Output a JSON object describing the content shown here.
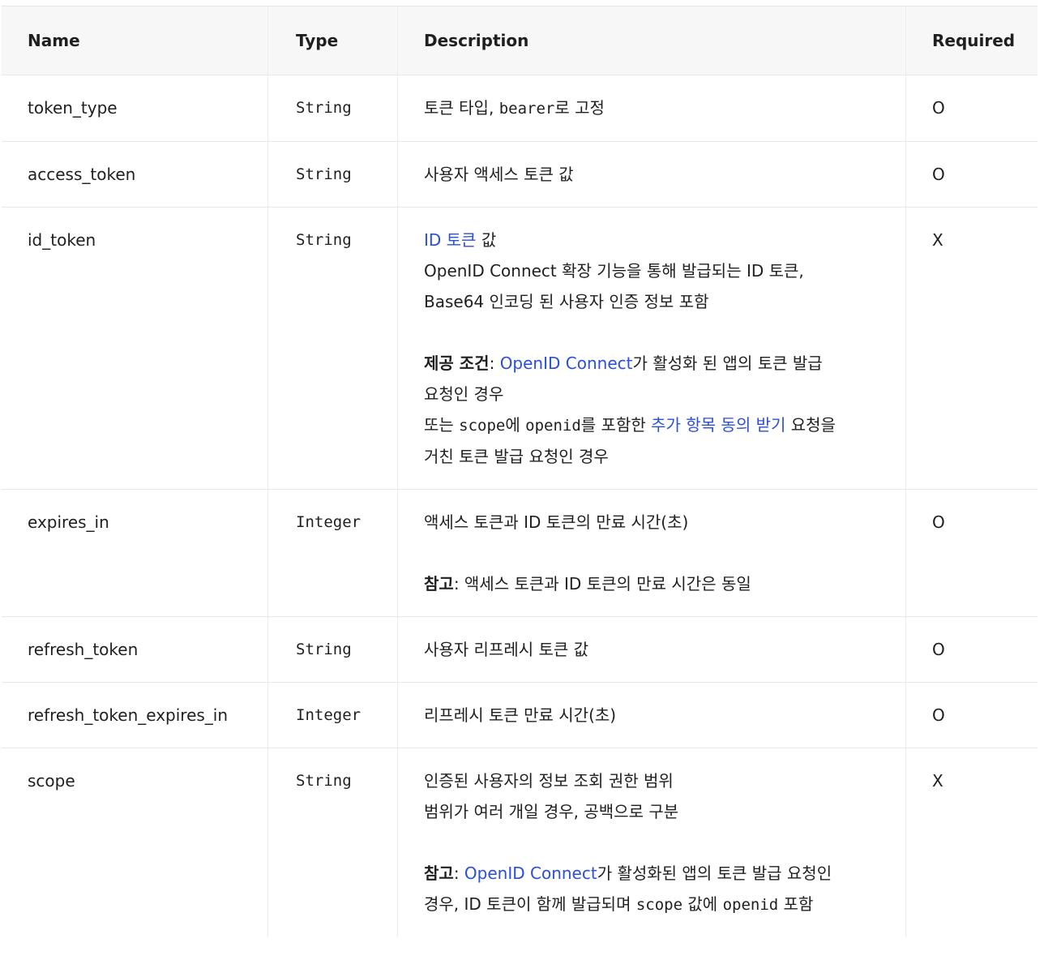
{
  "headers": {
    "name": "Name",
    "type": "Type",
    "description": "Description",
    "required": "Required"
  },
  "rows": {
    "token_type": {
      "name": "token_type",
      "type": "String",
      "desc_a": "토큰 타입, ",
      "desc_code": "bearer",
      "desc_b": "로 고정",
      "required": "O"
    },
    "access_token": {
      "name": "access_token",
      "type": "String",
      "desc": "사용자 액세스 토큰 값",
      "required": "O"
    },
    "id_token": {
      "name": "id_token",
      "type": "String",
      "link1": "ID 토큰",
      "line1_tail": " 값",
      "line2": "OpenID Connect 확장 기능을 통해 발급되는 ID 토큰,",
      "line3": "Base64 인코딩 된 사용자 인증 정보 포함",
      "cond_label": "제공 조건",
      "cond_colon": ": ",
      "cond_link": "OpenID Connect",
      "cond_tail": "가 활성화 된 앱의 토큰 발급",
      "line5": "요청인 경우",
      "l6_a": "또는 ",
      "l6_code1": "scope",
      "l6_b": "에 ",
      "l6_code2": "openid",
      "l6_c": "를 포함한 ",
      "l6_link": "추가 항목 동의 받기",
      "l6_d": " 요청을",
      "line7": "거친 토큰 발급 요청인 경우",
      "required": "X"
    },
    "expires_in": {
      "name": "expires_in",
      "type": "Integer",
      "line1": "액세스 토큰과 ID 토큰의 만료 시간(초)",
      "note_label": "참고",
      "note_text": ": 액세스 토큰과 ID 토큰의 만료 시간은 동일",
      "required": "O"
    },
    "refresh_token": {
      "name": "refresh_token",
      "type": "String",
      "desc": "사용자 리프레시 토큰 값",
      "required": "O"
    },
    "refresh_token_expires_in": {
      "name": "refresh_token_expires_in",
      "type": "Integer",
      "desc": "리프레시 토큰 만료 시간(초)",
      "required": "O"
    },
    "scope": {
      "name": "scope",
      "type": "String",
      "line1": "인증된 사용자의 정보 조회 권한 범위",
      "line2": "범위가 여러 개일 경우, 공백으로 구분",
      "note_label": "참고",
      "note_colon": ": ",
      "note_link": "OpenID Connect",
      "note_tail": "가 활성화된 앱의 토큰 발급 요청인",
      "l5_a": "경우, ID 토큰이 함께 발급되며 ",
      "l5_code1": "scope",
      "l5_b": " 값에 ",
      "l5_code2": "openid",
      "l5_c": " 포함",
      "required": "X"
    }
  },
  "colors": {
    "link": "#2b4fd6",
    "header_bg": "#f7f7f7",
    "border": "#e8e8e8"
  }
}
